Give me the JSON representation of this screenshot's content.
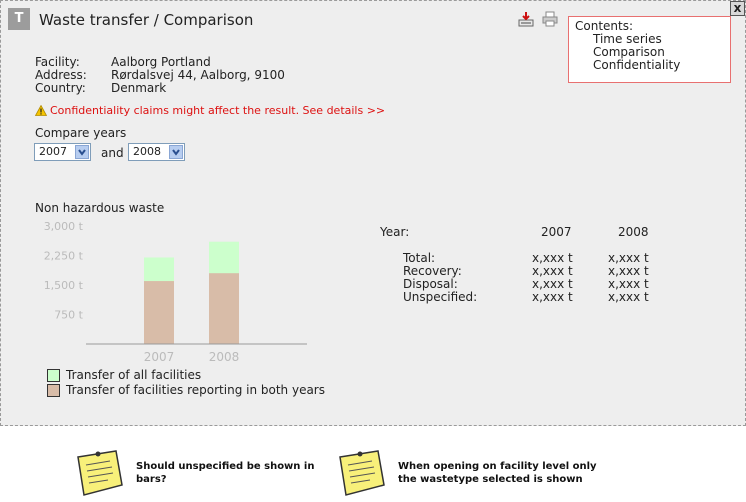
{
  "window": {
    "title": "Waste transfer / Comparison",
    "icon_letter": "T",
    "close_label": "x"
  },
  "contents": {
    "heading": "Contents:",
    "items": [
      "Time series",
      "Comparison",
      "Confidentiality"
    ]
  },
  "facility": {
    "rows": [
      {
        "label": "Facility:",
        "value": "Aalborg Portland"
      },
      {
        "label": "Address:",
        "value": "Rørdalsvej 44, Aalborg, 9100"
      },
      {
        "label": "Country:",
        "value": "Denmark"
      }
    ]
  },
  "warning": {
    "text": "Confidentiality claims might affect the result. See details >>"
  },
  "compare": {
    "label": "Compare years",
    "year1": "2007",
    "and_label": "and",
    "year2": "2008"
  },
  "chart_data": {
    "type": "bar",
    "title": "Non hazardous waste",
    "categories": [
      "2007",
      "2008"
    ],
    "series": [
      {
        "name": "Transfer of all facilities",
        "values": [
          2200,
          2600
        ],
        "color": "#ccffcc"
      },
      {
        "name": "Transfer of facilities reporting in both years",
        "values": [
          1600,
          1800
        ],
        "color": "#d8bca8"
      }
    ],
    "y_ticks": [
      "3,000 t",
      "2,250 t",
      "1,500 t",
      "750 t"
    ],
    "y_tick_values": [
      3000,
      2250,
      1500,
      750
    ],
    "ylim": [
      0,
      3000
    ]
  },
  "legend": {
    "items": [
      {
        "label": "Transfer of all facilities",
        "color": "#ccffcc"
      },
      {
        "label": "Transfer of facilities reporting in both years",
        "color": "#d8bca8"
      }
    ]
  },
  "summary_table": {
    "year_label": "Year:",
    "years": [
      "2007",
      "2008"
    ],
    "rows": [
      {
        "label": "Total:",
        "values": [
          "x,xxx t",
          "x,xxx t"
        ]
      },
      {
        "label": "Recovery:",
        "values": [
          "x,xxx t",
          "x,xxx t"
        ]
      },
      {
        "label": "Disposal:",
        "values": [
          "x,xxx t",
          "x,xxx t"
        ]
      },
      {
        "label": "Unspecified:",
        "values": [
          "x,xxx t",
          "x,xxx t"
        ]
      }
    ]
  },
  "notes": [
    {
      "icon": "sticky-note-icon",
      "lines": [
        "Should unspecified be shown in",
        "bars?"
      ]
    },
    {
      "icon": "sticky-note-icon",
      "lines": [
        "When opening on facility level only",
        "the wastetype selected is shown"
      ]
    }
  ],
  "colors": {
    "warning": "#dd1111",
    "contents_border": "#e87070",
    "panel": "#eeeeee"
  }
}
